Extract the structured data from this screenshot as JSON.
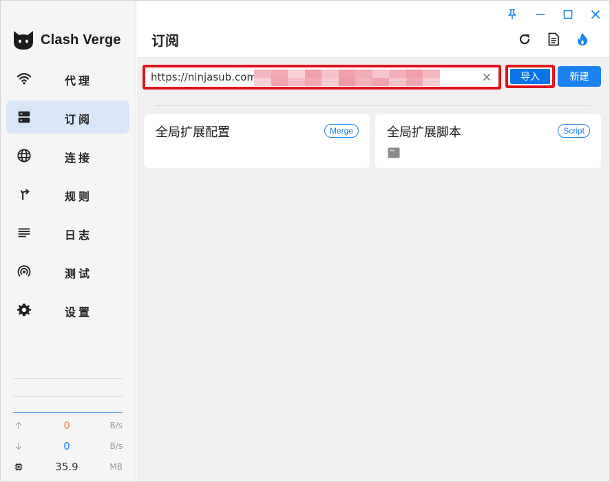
{
  "app": {
    "name": "Clash Verge"
  },
  "sidebar": {
    "items": [
      {
        "label": "代理",
        "icon": "wifi-icon",
        "active": false
      },
      {
        "label": "订阅",
        "icon": "dns-icon",
        "active": true
      },
      {
        "label": "连接",
        "icon": "globe-icon",
        "active": false
      },
      {
        "label": "规则",
        "icon": "fork-icon",
        "active": false
      },
      {
        "label": "日志",
        "icon": "list-icon",
        "active": false
      },
      {
        "label": "测试",
        "icon": "radar-icon",
        "active": false
      },
      {
        "label": "设置",
        "icon": "gear-icon",
        "active": false
      }
    ],
    "traffic": {
      "upload": {
        "value": "0",
        "unit": "B/s",
        "color": "#f08a5d"
      },
      "download": {
        "value": "0",
        "unit": "B/s",
        "color": "#1b82f1"
      },
      "memory": {
        "value": "35.9",
        "unit": "MB"
      }
    }
  },
  "header": {
    "title": "订阅"
  },
  "import_bar": {
    "url_value": "https://ninjasub.com/",
    "import_label": "导入",
    "new_label": "新建"
  },
  "cards": [
    {
      "title": "全局扩展配置",
      "chip": "Merge",
      "has_file_icon": false
    },
    {
      "title": "全局扩展脚本",
      "chip": "Script",
      "has_file_icon": true
    }
  ],
  "colors": {
    "accent": "#1b82f1",
    "highlight": "#e0141e",
    "active_bg": "#d9e6f7"
  }
}
